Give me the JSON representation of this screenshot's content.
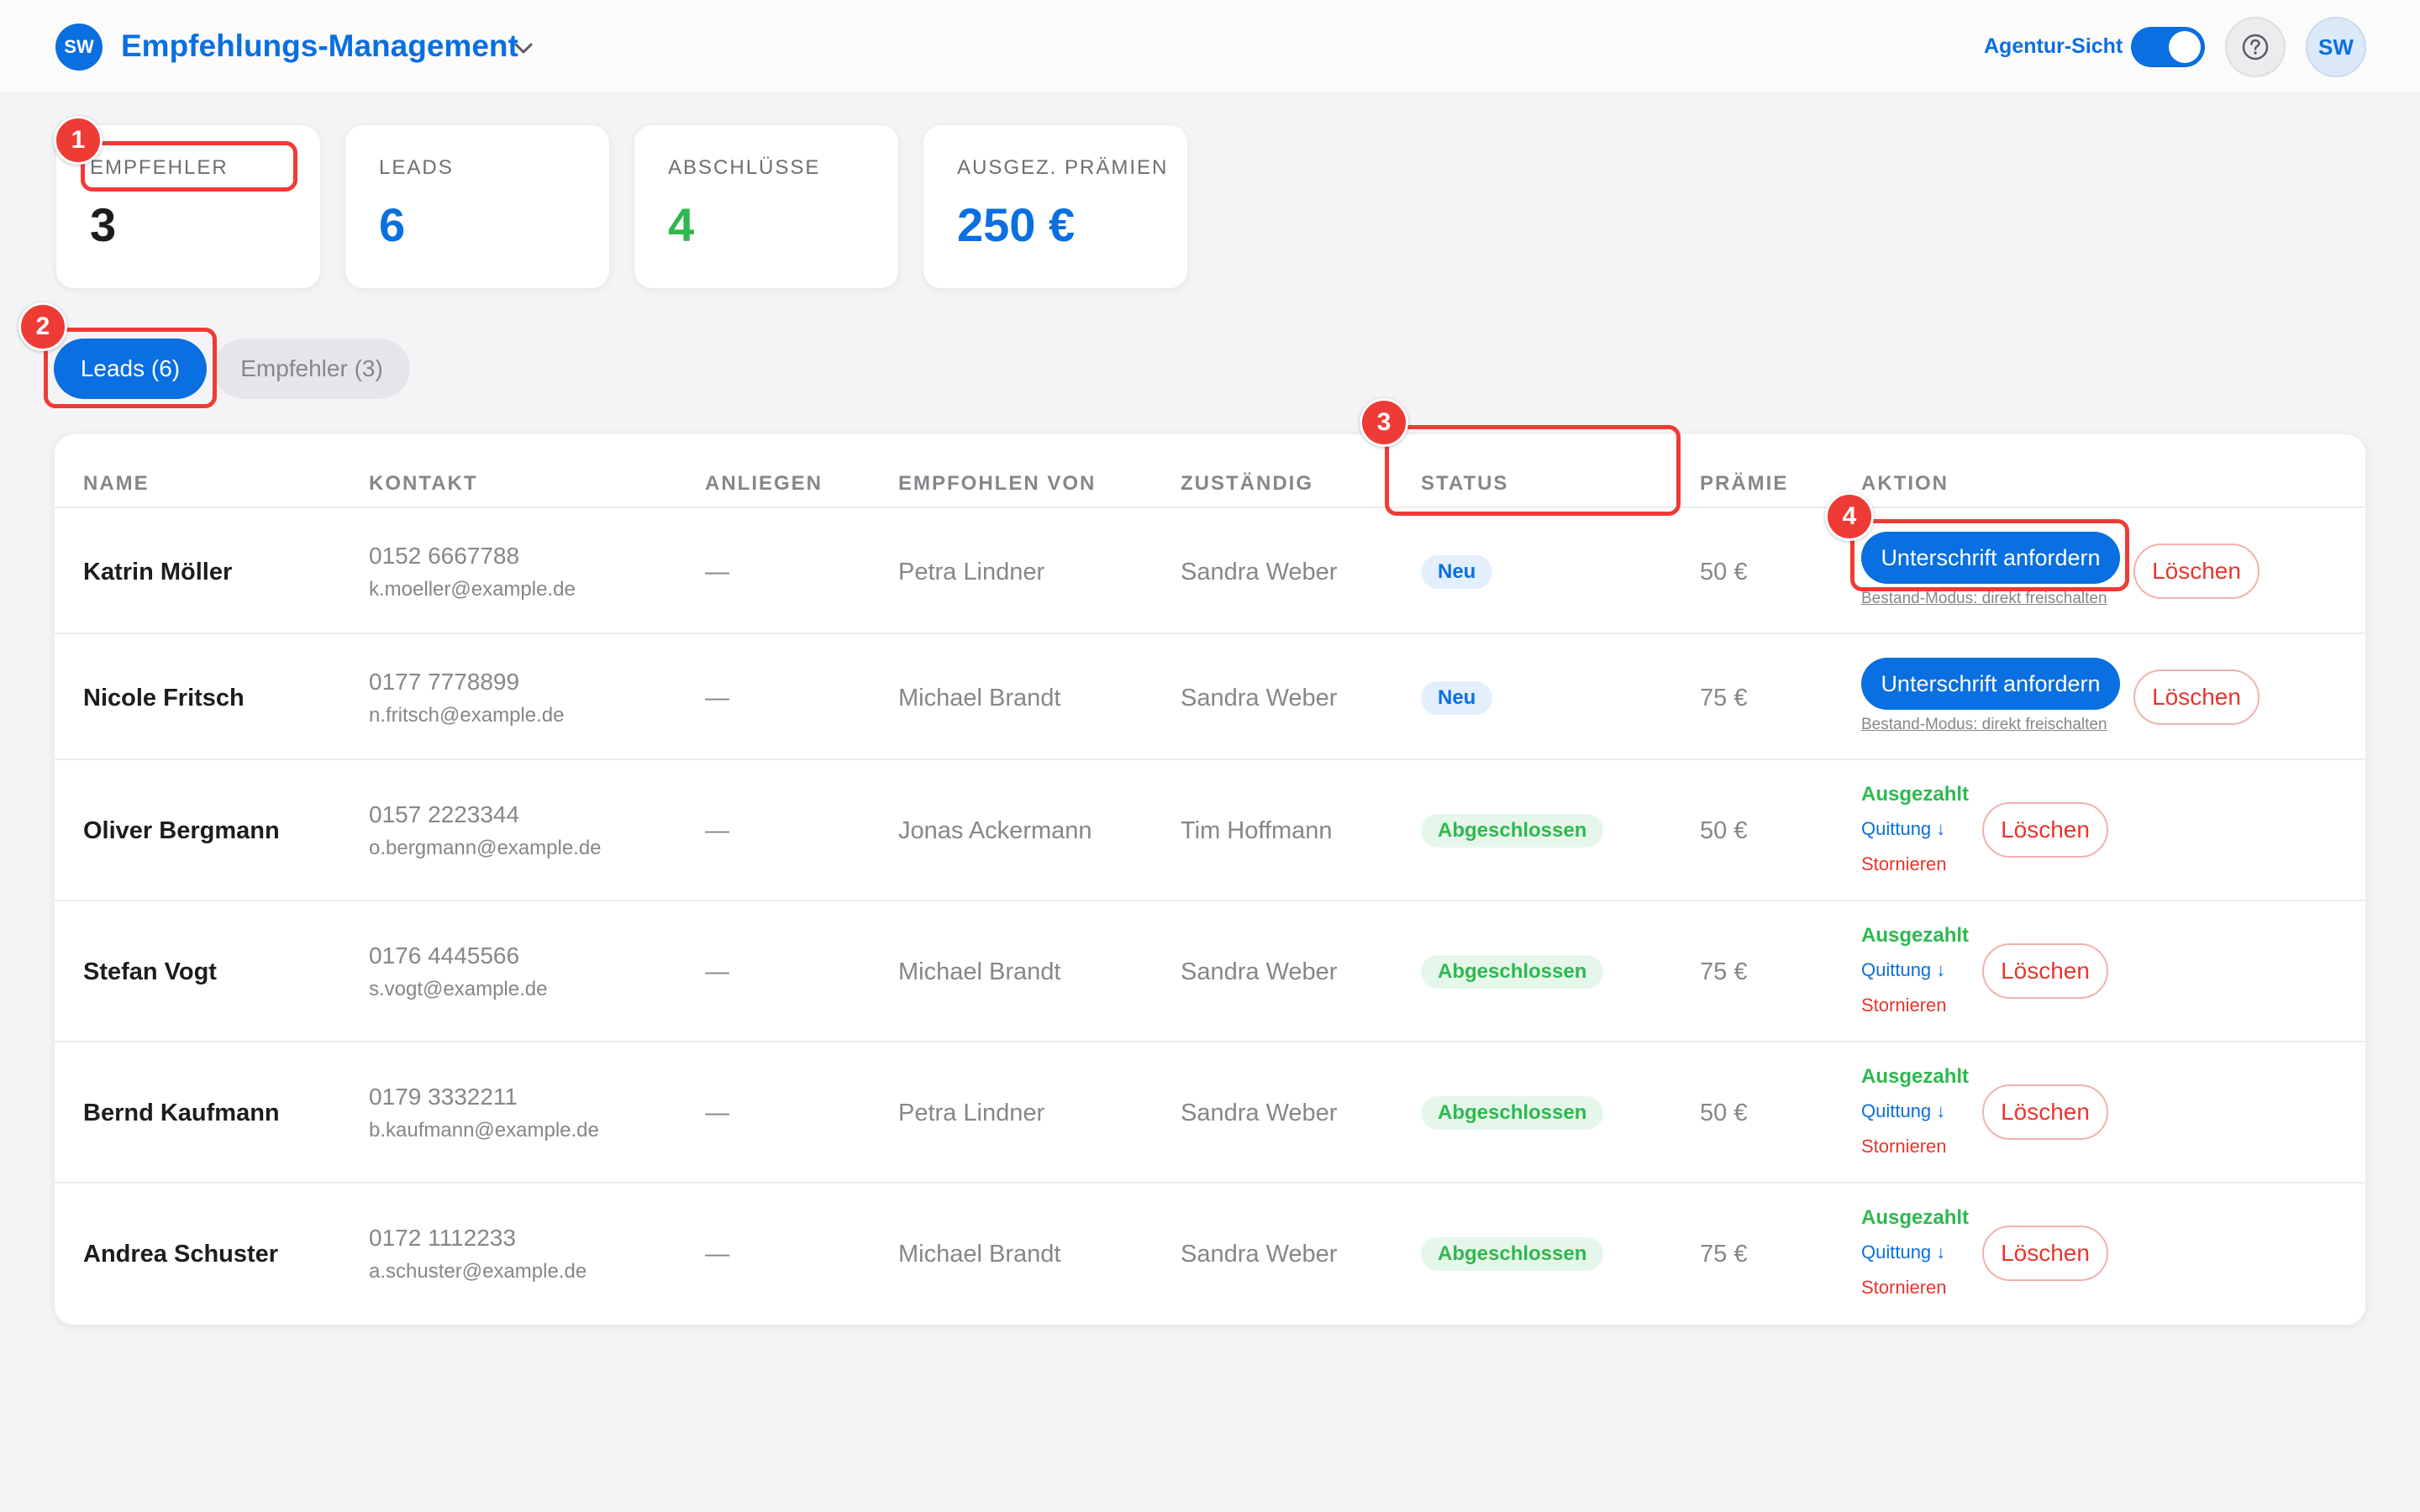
{
  "header": {
    "logo_initials": "SW",
    "app_title": "Empfehlungs-Management",
    "agency_view_label": "Agentur-Sicht",
    "agency_view_on": true,
    "avatar_initials": "SW"
  },
  "kpis": [
    {
      "label": "EMPFEHLER",
      "value": "3",
      "color": "#1d1d1f"
    },
    {
      "label": "LEADS",
      "value": "6",
      "color": "#0a6fe0"
    },
    {
      "label": "ABSCHLÜSSE",
      "value": "4",
      "color": "#2eb84f"
    },
    {
      "label": "AUSGEZ. PRÄMIEN",
      "value": "250 €",
      "color": "#0a6fe0"
    }
  ],
  "tabs": [
    {
      "label": "Leads (6)",
      "active": true
    },
    {
      "label": "Empfehler (3)",
      "active": false
    }
  ],
  "table": {
    "columns": [
      "NAME",
      "KONTAKT",
      "ANLIEGEN",
      "EMPFOHLEN VON",
      "ZUSTÄNDIG",
      "STATUS",
      "PRÄMIE",
      "AKTION"
    ],
    "rows": [
      {
        "name": "Katrin Möller",
        "phone": "0152 6667788",
        "email": "k.moeller@example.de",
        "concern": "—",
        "referred_by": "Petra Lindner",
        "assignee": "Sandra Weber",
        "status": "Neu",
        "status_type": "new",
        "bonus": "50 €",
        "actions": {
          "primary": "Unterschrift anfordern",
          "secondary_link": "Bestand-Modus: direkt freischalten",
          "delete": "Löschen"
        }
      },
      {
        "name": "Nicole Fritsch",
        "phone": "0177 7778899",
        "email": "n.fritsch@example.de",
        "concern": "—",
        "referred_by": "Michael Brandt",
        "assignee": "Sandra Weber",
        "status": "Neu",
        "status_type": "new",
        "bonus": "75 €",
        "actions": {
          "primary": "Unterschrift anfordern",
          "secondary_link": "Bestand-Modus: direkt freischalten",
          "delete": "Löschen"
        }
      },
      {
        "name": "Oliver Bergmann",
        "phone": "0157 2223344",
        "email": "o.bergmann@example.de",
        "concern": "—",
        "referred_by": "Jonas Ackermann",
        "assignee": "Tim Hoffmann",
        "status": "Abgeschlossen",
        "status_type": "done",
        "bonus": "50 €",
        "actions": {
          "paid": "Ausgezahlt",
          "receipt": "Quittung ↓",
          "cancel": "Stornieren",
          "delete": "Löschen"
        }
      },
      {
        "name": "Stefan Vogt",
        "phone": "0176 4445566",
        "email": "s.vogt@example.de",
        "concern": "—",
        "referred_by": "Michael Brandt",
        "assignee": "Sandra Weber",
        "status": "Abgeschlossen",
        "status_type": "done",
        "bonus": "75 €",
        "actions": {
          "paid": "Ausgezahlt",
          "receipt": "Quittung ↓",
          "cancel": "Stornieren",
          "delete": "Löschen"
        }
      },
      {
        "name": "Bernd Kaufmann",
        "phone": "0179 3332211",
        "email": "b.kaufmann@example.de",
        "concern": "—",
        "referred_by": "Petra Lindner",
        "assignee": "Sandra Weber",
        "status": "Abgeschlossen",
        "status_type": "done",
        "bonus": "50 €",
        "actions": {
          "paid": "Ausgezahlt",
          "receipt": "Quittung ↓",
          "cancel": "Stornieren",
          "delete": "Löschen"
        }
      },
      {
        "name": "Andrea Schuster",
        "phone": "0172 1112233",
        "email": "a.schuster@example.de",
        "concern": "—",
        "referred_by": "Michael Brandt",
        "assignee": "Sandra Weber",
        "status": "Abgeschlossen",
        "status_type": "done",
        "bonus": "75 €",
        "actions": {
          "paid": "Ausgezahlt",
          "receipt": "Quittung ↓",
          "cancel": "Stornieren",
          "delete": "Löschen"
        }
      }
    ]
  },
  "annotations": [
    "1",
    "2",
    "3",
    "4"
  ],
  "colors": {
    "accent": "#0a6fe0",
    "success": "#2eb84f",
    "danger": "#e8352c",
    "annotation": "#ef3b36"
  }
}
